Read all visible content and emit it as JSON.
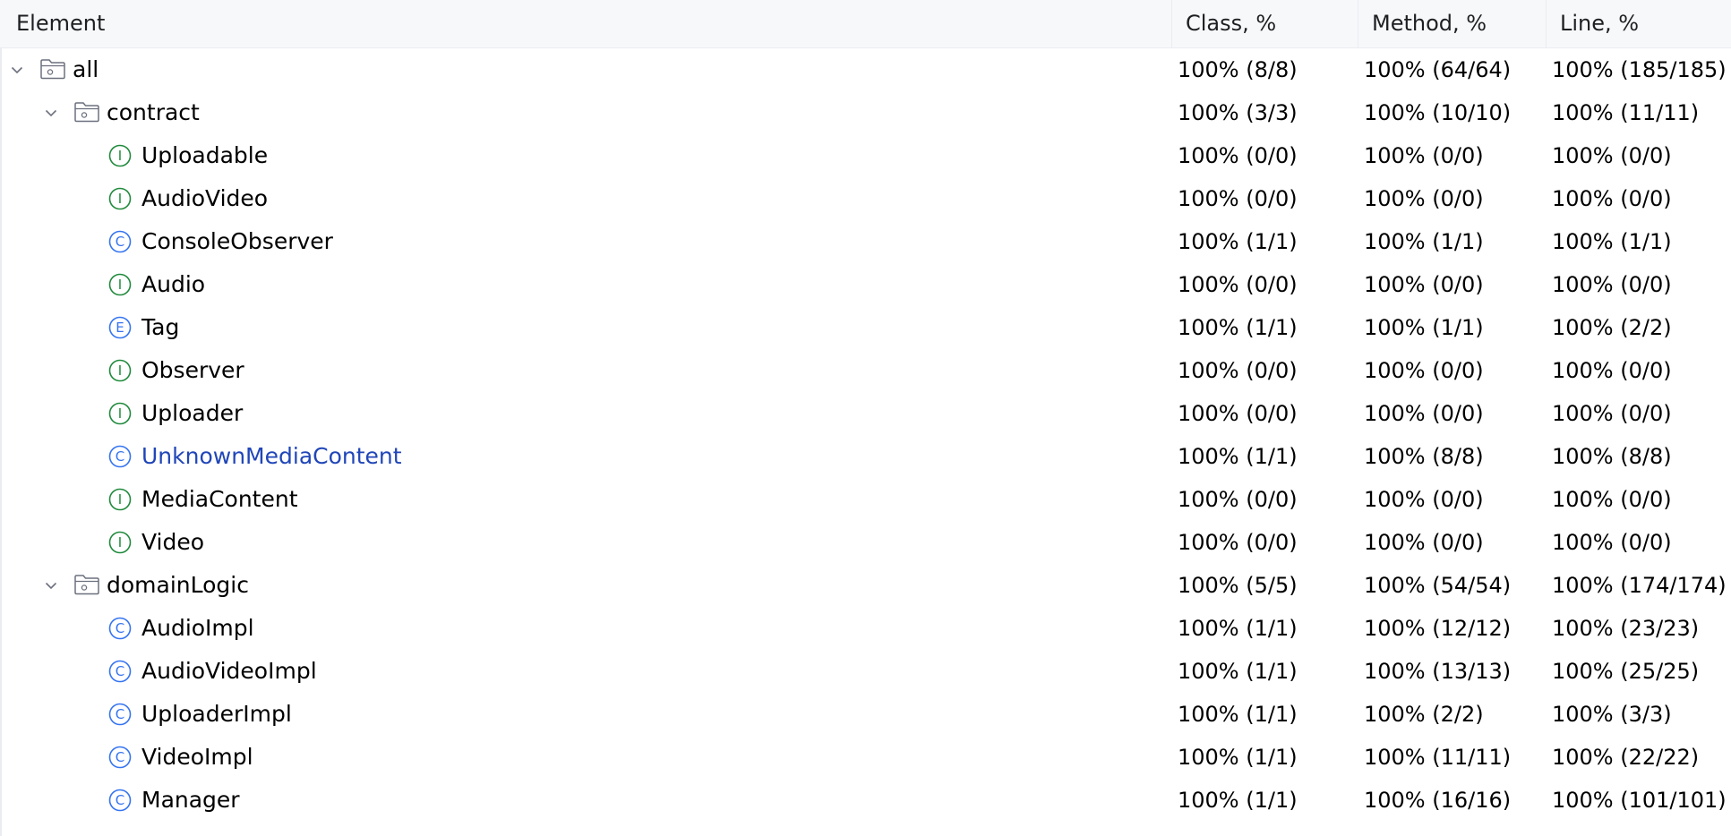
{
  "table": {
    "columns": {
      "element": "Element",
      "class": "Class, %",
      "method": "Method, %",
      "line": "Line, %"
    },
    "rows": [
      {
        "name": "all",
        "type": "package",
        "level": 0,
        "class": "100% (8/8)",
        "method": "100% (64/64)",
        "line": "100% (185/185)"
      },
      {
        "name": "contract",
        "type": "package",
        "level": 1,
        "class": "100% (3/3)",
        "method": "100% (10/10)",
        "line": "100% (11/11)"
      },
      {
        "name": "Uploadable",
        "type": "interface",
        "level": 2,
        "class": "100% (0/0)",
        "method": "100% (0/0)",
        "line": "100% (0/0)"
      },
      {
        "name": "AudioVideo",
        "type": "interface",
        "level": 2,
        "class": "100% (0/0)",
        "method": "100% (0/0)",
        "line": "100% (0/0)"
      },
      {
        "name": "ConsoleObserver",
        "type": "class",
        "level": 2,
        "class": "100% (1/1)",
        "method": "100% (1/1)",
        "line": "100% (1/1)"
      },
      {
        "name": "Audio",
        "type": "interface",
        "level": 2,
        "class": "100% (0/0)",
        "method": "100% (0/0)",
        "line": "100% (0/0)"
      },
      {
        "name": "Tag",
        "type": "enum",
        "level": 2,
        "class": "100% (1/1)",
        "method": "100% (1/1)",
        "line": "100% (2/2)"
      },
      {
        "name": "Observer",
        "type": "interface",
        "level": 2,
        "class": "100% (0/0)",
        "method": "100% (0/0)",
        "line": "100% (0/0)"
      },
      {
        "name": "Uploader",
        "type": "interface",
        "level": 2,
        "class": "100% (0/0)",
        "method": "100% (0/0)",
        "line": "100% (0/0)"
      },
      {
        "name": "UnknownMediaContent",
        "type": "class",
        "level": 2,
        "highlight": true,
        "class": "100% (1/1)",
        "method": "100% (8/8)",
        "line": "100% (8/8)"
      },
      {
        "name": "MediaContent",
        "type": "interface",
        "level": 2,
        "class": "100% (0/0)",
        "method": "100% (0/0)",
        "line": "100% (0/0)"
      },
      {
        "name": "Video",
        "type": "interface",
        "level": 2,
        "class": "100% (0/0)",
        "method": "100% (0/0)",
        "line": "100% (0/0)"
      },
      {
        "name": "domainLogic",
        "type": "package",
        "level": 1,
        "class": "100% (5/5)",
        "method": "100% (54/54)",
        "line": "100% (174/174)"
      },
      {
        "name": "AudioImpl",
        "type": "class",
        "level": 2,
        "class": "100% (1/1)",
        "method": "100% (12/12)",
        "line": "100% (23/23)"
      },
      {
        "name": "AudioVideoImpl",
        "type": "class",
        "level": 2,
        "class": "100% (1/1)",
        "method": "100% (13/13)",
        "line": "100% (25/25)"
      },
      {
        "name": "UploaderImpl",
        "type": "class",
        "level": 2,
        "class": "100% (1/1)",
        "method": "100% (2/2)",
        "line": "100% (3/3)"
      },
      {
        "name": "VideoImpl",
        "type": "class",
        "level": 2,
        "class": "100% (1/1)",
        "method": "100% (11/11)",
        "line": "100% (22/22)"
      },
      {
        "name": "Manager",
        "type": "class",
        "level": 2,
        "class": "100% (1/1)",
        "method": "100% (16/16)",
        "line": "100% (101/101)"
      }
    ]
  },
  "icons": {
    "package": "folder-package-icon",
    "interface": "interface-icon",
    "class": "class-icon",
    "enum": "enum-icon",
    "expanded": "chevron-down-icon"
  },
  "badge_letters": {
    "interface": "I",
    "class": "C",
    "enum": "E"
  },
  "colors": {
    "interface": "#208a3c",
    "class": "#3574f0",
    "enum": "#3574f0",
    "link": "#2046b8",
    "header_bg": "#f7f8fa",
    "separator": "#ebecf0",
    "folder_stroke": "#6c707e"
  }
}
